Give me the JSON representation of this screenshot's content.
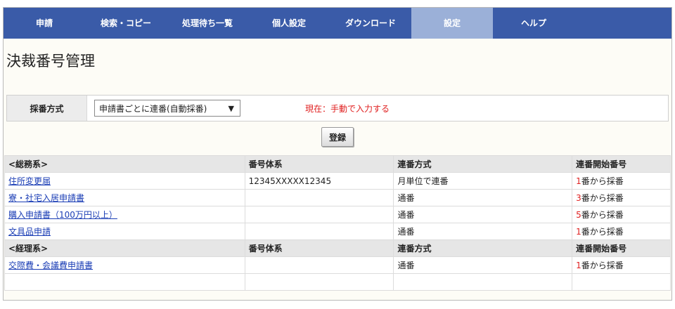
{
  "nav": {
    "items": [
      {
        "label": "申請",
        "active": false
      },
      {
        "label": "検索・コピー",
        "active": false
      },
      {
        "label": "処理待ち一覧",
        "active": false
      },
      {
        "label": "個人設定",
        "active": false
      },
      {
        "label": "ダウンロード",
        "active": false
      },
      {
        "label": "設定",
        "active": true
      },
      {
        "label": "ヘルプ",
        "active": false
      }
    ]
  },
  "page_title": "決裁番号管理",
  "numbering": {
    "label": "採番方式",
    "selected": "申請書ごとに連番(自動採番)",
    "current_status": "現在：手動で入力する"
  },
  "register_label": "登録",
  "table": {
    "groups": [
      {
        "name": "<総務系>",
        "headers": [
          "番号体系",
          "連番方式",
          "連番開始番号"
        ],
        "rows": [
          {
            "name": "住所変更届",
            "scheme": "12345XXXXX12345",
            "method": "月単位で連番",
            "start_num": "1",
            "start_suffix": "番から採番"
          },
          {
            "name": "寮・社宅入居申請書",
            "scheme": "",
            "method": "通番",
            "start_num": "3",
            "start_suffix": "番から採番"
          },
          {
            "name": "購入申請書（100万円以上）",
            "scheme": "",
            "method": "通番",
            "start_num": "5",
            "start_suffix": "番から採番"
          },
          {
            "name": "文具品申請",
            "scheme": "",
            "method": "通番",
            "start_num": "1",
            "start_suffix": "番から採番"
          }
        ]
      },
      {
        "name": "<経理系>",
        "headers": [
          "番号体系",
          "連番方式",
          "連番開始番号"
        ],
        "rows": [
          {
            "name": "交際費・会議費申請書",
            "scheme": "",
            "method": "通番",
            "start_num": "1",
            "start_suffix": "番から採番"
          }
        ]
      }
    ]
  },
  "colors": {
    "nav_bg": "#3a5ba8",
    "nav_active": "#9bb0d8",
    "link": "#1a3db5",
    "red": "#e02020"
  }
}
